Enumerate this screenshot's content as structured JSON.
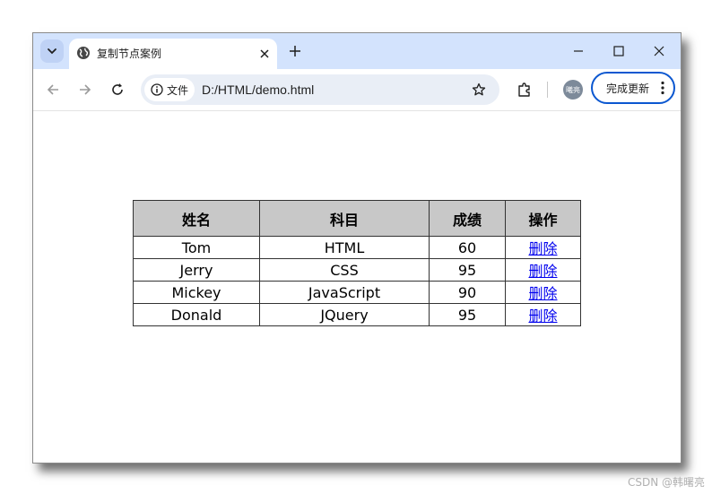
{
  "browser": {
    "tab_title": "复制节点案例",
    "site_chip_label": "文件",
    "url": "D:/HTML/demo.html",
    "profile_label": "曦亮",
    "update_button_label": "完成更新"
  },
  "table": {
    "headers": [
      "姓名",
      "科目",
      "成绩",
      "操作"
    ],
    "rows": [
      {
        "name": "Tom",
        "subject": "HTML",
        "score": "60",
        "action": "删除"
      },
      {
        "name": "Jerry",
        "subject": "CSS",
        "score": "95",
        "action": "删除"
      },
      {
        "name": "Mickey",
        "subject": "JavaScript",
        "score": "90",
        "action": "删除"
      },
      {
        "name": "Donald",
        "subject": "JQuery",
        "score": "95",
        "action": "删除"
      }
    ]
  },
  "watermark": "CSDN @韩曙亮",
  "colors": {
    "tabbar_bg": "#d3e3fd",
    "omnibox_bg": "#e9eef6",
    "accent": "#0b57d0",
    "header_cell_bg": "#c8c8c8",
    "link": "#0000ee"
  }
}
